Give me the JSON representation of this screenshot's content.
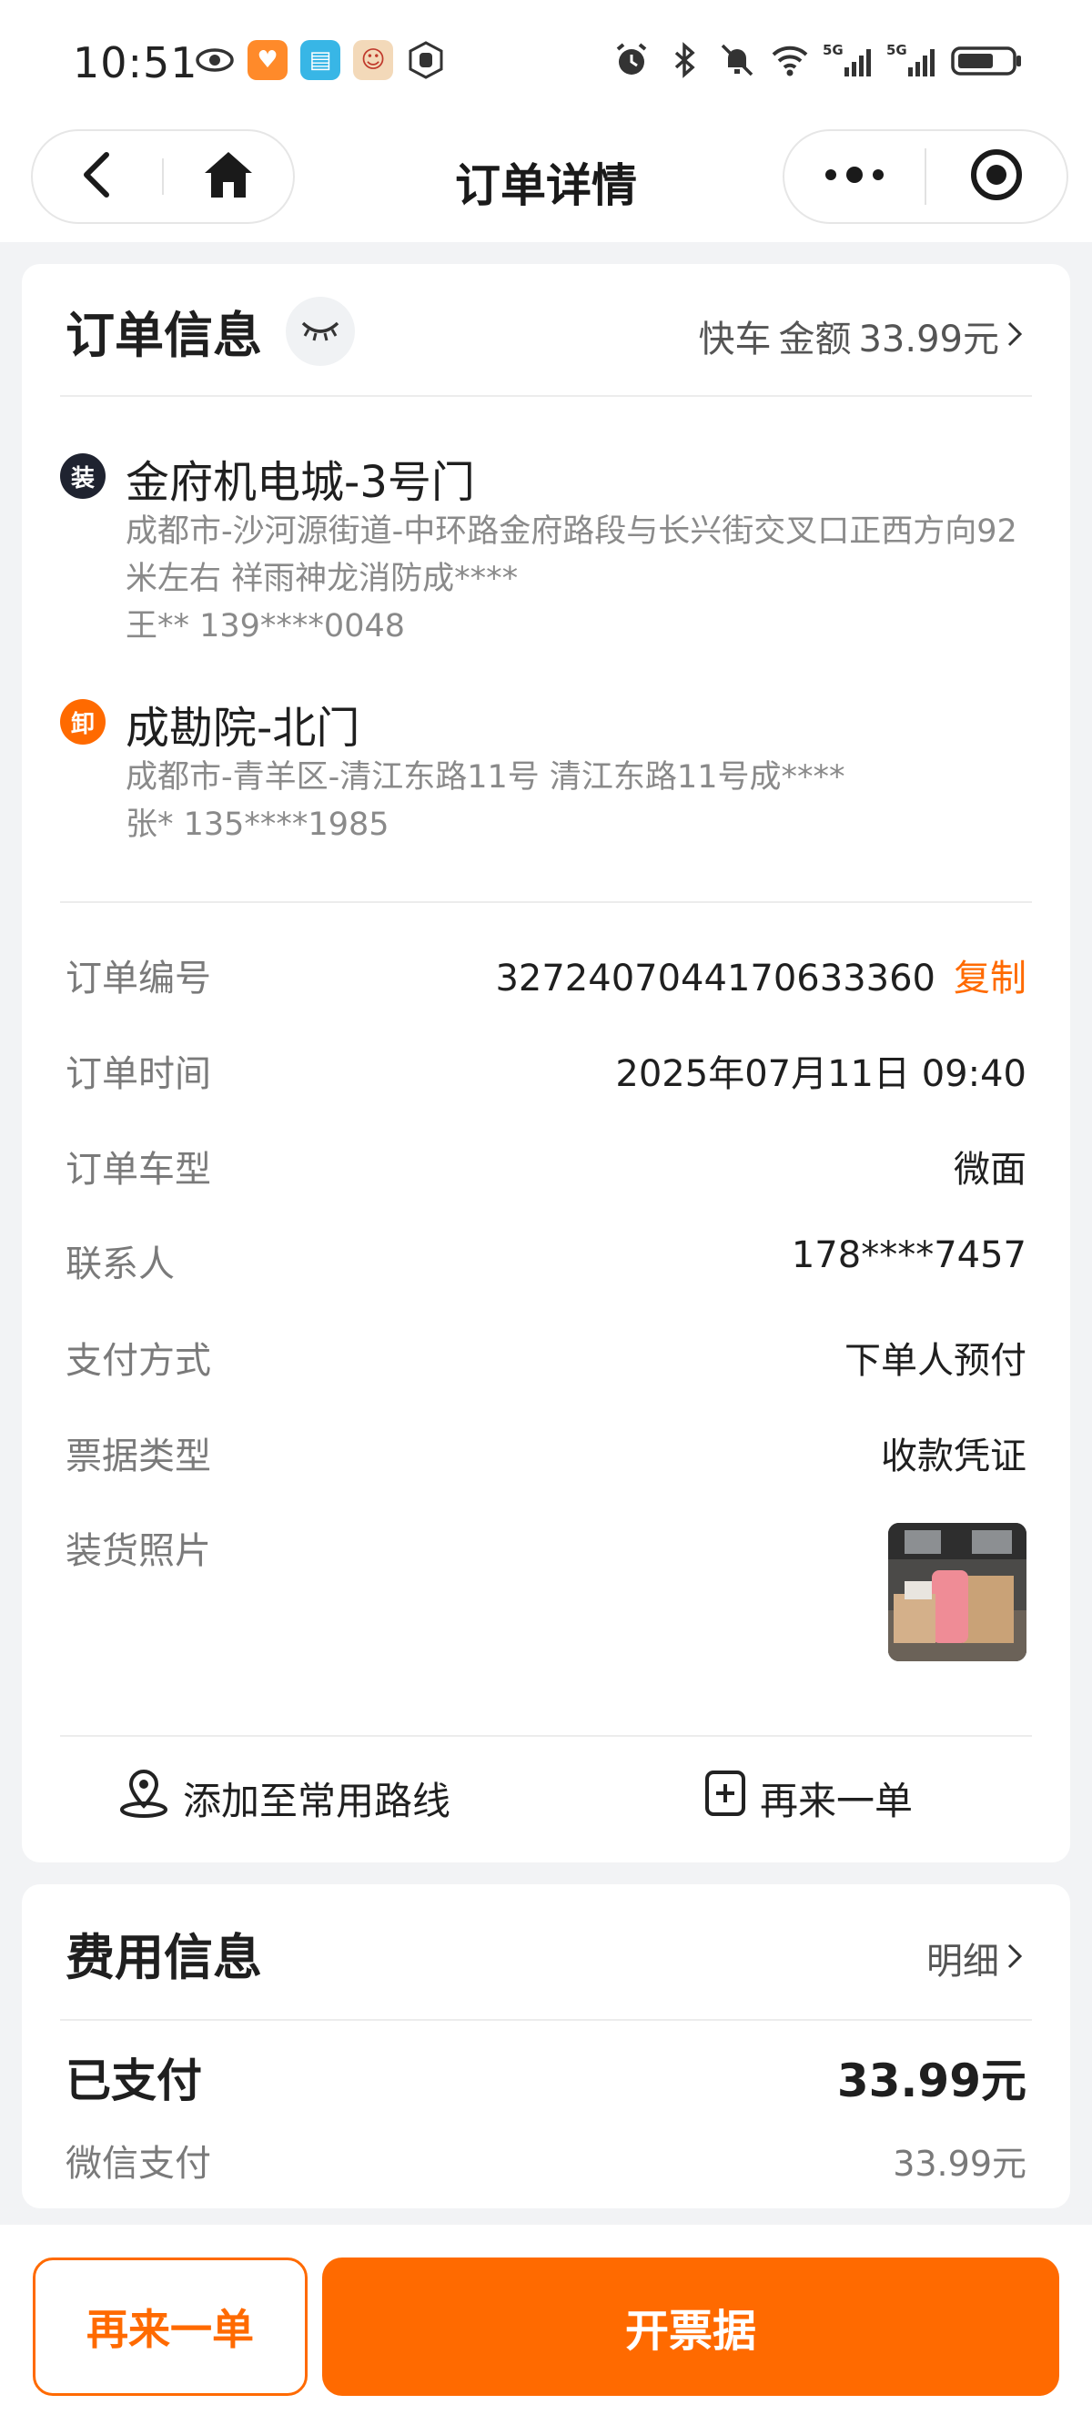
{
  "status_bar": {
    "time": "10:51",
    "network_1": "5G",
    "network_2": "5G"
  },
  "nav": {
    "title": "订单详情",
    "back_icon": "chevron-left-icon",
    "home_icon": "home-icon",
    "more_icon": "more-dots-icon",
    "close_icon": "target-circle-icon"
  },
  "order_info": {
    "title": "订单信息",
    "service_type": "快车",
    "amount_label": "金额",
    "amount": "33.99元",
    "pickup": {
      "badge": "装",
      "name": "金府机电城-3号门",
      "address": "成都市-沙河源街道-中环路金府路段与长兴街交叉口正西方向92米左右 祥雨神龙消防成****",
      "contact": "王** 139****0048"
    },
    "dropoff": {
      "badge": "卸",
      "name": "成勘院-北门",
      "address": "成都市-青羊区-清江东路11号 清江东路11号成****",
      "contact": "张* 135****1985"
    },
    "rows": [
      {
        "label": "订单编号",
        "value": "3272407044170633360",
        "action": "复制"
      },
      {
        "label": "订单时间",
        "value": "2025年07月11日 09:40"
      },
      {
        "label": "订单车型",
        "value": "微面"
      },
      {
        "label": "联系人",
        "value": "178****7457"
      },
      {
        "label": "支付方式",
        "value": "下单人预付"
      },
      {
        "label": "票据类型",
        "value": "收款凭证"
      },
      {
        "label": "装货照片",
        "value": ""
      }
    ],
    "actions": {
      "add_route": "添加至常用路线",
      "reorder": "再来一单"
    }
  },
  "fee_info": {
    "title": "费用信息",
    "detail_link": "明细",
    "paid_label": "已支付",
    "paid_amount": "33.99元",
    "pay_method": "微信支付",
    "pay_amount": "33.99元"
  },
  "bottom": {
    "reorder_button": "再来一单",
    "invoice_button": "开票据"
  },
  "colors": {
    "accent": "#ff6a00",
    "load_badge": "#1f2330"
  }
}
